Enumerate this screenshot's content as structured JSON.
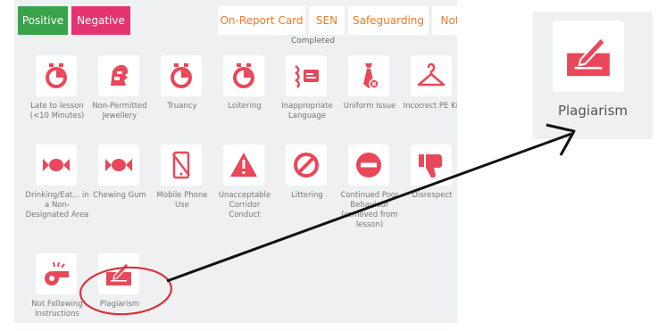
{
  "tabs": {
    "positive": "Positive",
    "negative": "Negative",
    "on_report_card": "On-Report Card",
    "sen": "SEN",
    "safeguarding": "Safeguarding",
    "notes": "Not",
    "completed": "Completed"
  },
  "colors": {
    "positive": "#3aa24a",
    "negative": "#e43470",
    "icon": "#e8485a",
    "tab_text": "#ef7a2a",
    "annotation_circle": "#d8323a",
    "arrow": "#111111"
  },
  "behaviours": [
    {
      "label": "Late to lesson (<10 Minutes)",
      "icon": "stopwatch-icon"
    },
    {
      "label": "Non-Permitted Jewellery",
      "icon": "helmet-icon"
    },
    {
      "label": "Truancy",
      "icon": "stopwatch-icon"
    },
    {
      "label": "Loitering",
      "icon": "stopwatch-icon"
    },
    {
      "label": "Inappropriate Language",
      "icon": "speech-icon"
    },
    {
      "label": "Uniform Issue",
      "icon": "tie-icon"
    },
    {
      "label": "Incorrect PE Kit",
      "icon": "hanger-icon"
    },
    {
      "label": "Drinking/Eat... in a Non-Designated Area",
      "icon": "candy-icon"
    },
    {
      "label": "Chewing Gum",
      "icon": "candy-icon"
    },
    {
      "label": "Mobile Phone Use",
      "icon": "no-phone-icon"
    },
    {
      "label": "Unacceptable Corridor Conduct",
      "icon": "warning-icon"
    },
    {
      "label": "Littering",
      "icon": "prohibited-icon"
    },
    {
      "label": "Continued Poor Behaviour (removed from lesson)",
      "icon": "no-entry-icon"
    },
    {
      "label": "Disrespect",
      "icon": "thumbs-down-icon"
    },
    {
      "label": "Not Following Instructions",
      "icon": "whistle-icon"
    },
    {
      "label": "Plagiarism",
      "icon": "signature-icon"
    }
  ],
  "callout": {
    "label": "Plagiarism",
    "icon": "signature-icon"
  }
}
